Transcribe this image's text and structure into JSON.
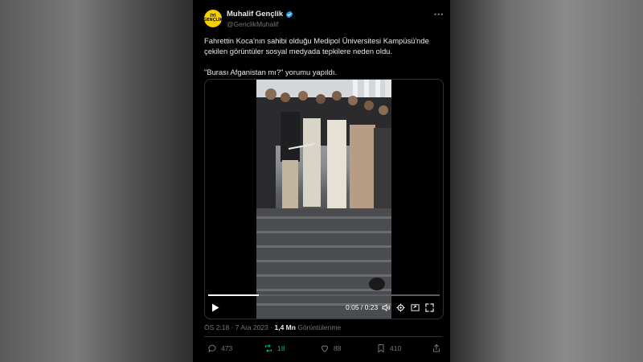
{
  "tweet": {
    "avatar_text": "İYİ GENÇLİK",
    "display_name": "Muhalif Gençlik",
    "handle": "@GenclikMuhalif",
    "verified_color": "#1d9bf0",
    "text_line1": "Fahrettin Koca'nın sahibi olduğu Medipol Üniversitesi Kampüsü'nde çekilen görüntüler sosyal medyada tepkilere neden oldu.",
    "text_line2": "\"Burası Afganistan mı?\" yorumu yapıldı.",
    "time": "ÖS 2:18",
    "date": "7 Ara 2023",
    "separator": "·",
    "views_count": "1,4 Mn",
    "views_label": "Görüntülenme"
  },
  "video": {
    "current_time": "0:05",
    "duration": "0:23",
    "time_separator": "/",
    "progress": 0.22,
    "controls": [
      "play-icon",
      "volume-icon",
      "settings-icon",
      "pip-icon",
      "fullscreen-icon"
    ]
  },
  "actions": {
    "replies": "473",
    "reposts": "18",
    "likes": "88",
    "bookmarks": "410",
    "repost_color": "#00ba7c"
  }
}
